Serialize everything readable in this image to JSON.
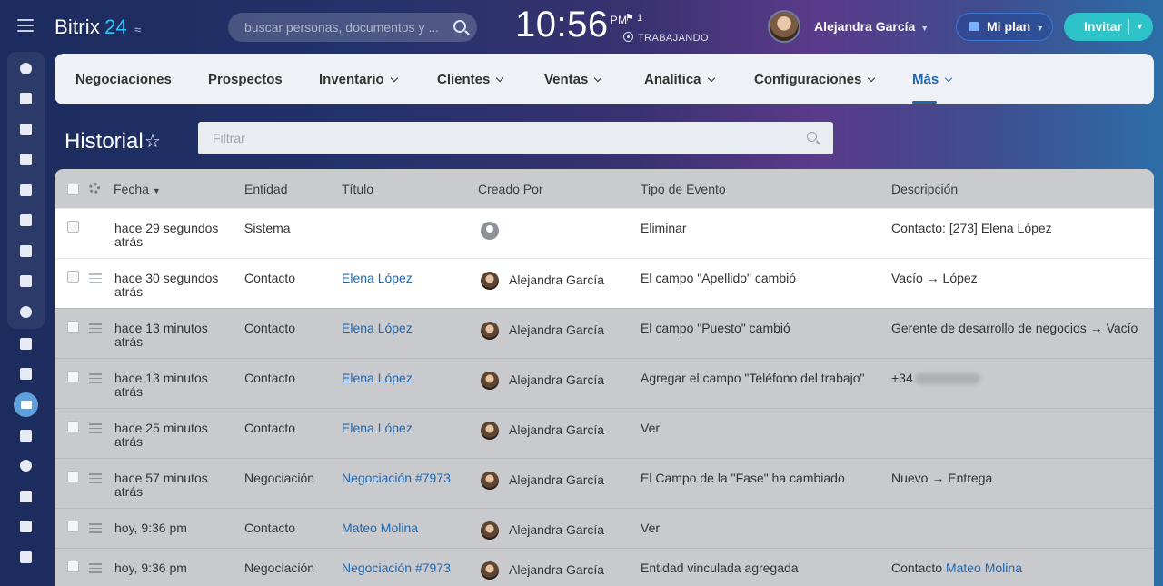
{
  "header": {
    "logo_text": "Bitrix",
    "logo_num": "24",
    "search_placeholder": "buscar personas, documentos y ...",
    "clock_time": "10:56",
    "clock_ampm": "PM",
    "flag_count": "1",
    "work_status": "TRABAJANDO",
    "user_name": "Alejandra García",
    "plan_label": "Mi plan",
    "invite_label": "Invitar"
  },
  "nav": {
    "items": [
      {
        "label": "Negociaciones"
      },
      {
        "label": "Prospectos"
      },
      {
        "label": "Inventario"
      },
      {
        "label": "Clientes"
      },
      {
        "label": "Ventas"
      },
      {
        "label": "Analítica"
      },
      {
        "label": "Configuraciones"
      },
      {
        "label": "Más"
      }
    ]
  },
  "page": {
    "title": "Historial",
    "filter_placeholder": "Filtrar"
  },
  "table": {
    "columns": [
      "Fecha",
      "Entidad",
      "Título",
      "Creado Por",
      "Tipo de Evento",
      "Descripción"
    ],
    "rows": [
      {
        "fecha": "hace 29 segundos atrás",
        "entidad": "Sistema",
        "titulo": "",
        "creado": "",
        "tipo": "Eliminar",
        "desc": "Contacto: [273] Elena López",
        "desc_link": ""
      },
      {
        "fecha": "hace 30 segundos atrás",
        "entidad": "Contacto",
        "titulo": "Elena López",
        "creado": "Alejandra García",
        "tipo": "El campo \"Apellido\" cambió",
        "desc": "Vacío → López",
        "desc_link": ""
      },
      {
        "fecha": "hace 13 minutos atrás",
        "entidad": "Contacto",
        "titulo": "Elena López",
        "creado": "Alejandra García",
        "tipo": "El campo \"Puesto\" cambió",
        "desc": "Gerente de desarrollo de negocios → Vacío",
        "desc_link": ""
      },
      {
        "fecha": "hace 13 minutos atrás",
        "entidad": "Contacto",
        "titulo": "Elena López",
        "creado": "Alejandra García",
        "tipo": "Agregar el campo \"Teléfono del trabajo\"",
        "desc": "+34",
        "desc_link": ""
      },
      {
        "fecha": "hace 25 minutos atrás",
        "entidad": "Contacto",
        "titulo": "Elena López",
        "creado": "Alejandra García",
        "tipo": "Ver",
        "desc": "",
        "desc_link": ""
      },
      {
        "fecha": "hace 57 minutos atrás",
        "entidad": "Negociación",
        "titulo": "Negociación #7973",
        "creado": "Alejandra García",
        "tipo": "El Campo de la \"Fase\" ha cambiado",
        "desc": "Nuevo → Entrega",
        "desc_link": ""
      },
      {
        "fecha": "hoy, 9:36 pm",
        "entidad": "Contacto",
        "titulo": "Mateo Molina",
        "creado": "Alejandra García",
        "tipo": "Ver",
        "desc": "",
        "desc_link": ""
      },
      {
        "fecha": "hoy, 9:36 pm",
        "entidad": "Negociación",
        "titulo": "Negociación #7973",
        "creado": "Alejandra García",
        "tipo": "Entidad vinculada agregada",
        "desc": "Contacto",
        "desc_link": "Mateo Molina"
      }
    ]
  },
  "colors": {
    "accent": "#2067b0",
    "invite": "#2ec3c8",
    "logo_num": "#2fc6f6"
  }
}
